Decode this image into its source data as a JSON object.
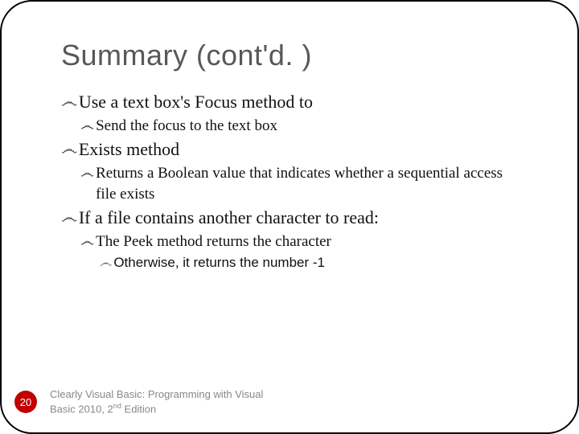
{
  "title": "Summary (cont'd. )",
  "bullets": [
    {
      "level": 1,
      "text": "Use a text box's Focus method to"
    },
    {
      "level": 2,
      "text": "Send the focus to the text box"
    },
    {
      "level": 1,
      "text": "Exists method"
    },
    {
      "level": 2,
      "text": "Returns a Boolean value that indicates whether a sequential access file exists"
    },
    {
      "level": 1,
      "text": "If a file contains another character to read:"
    },
    {
      "level": 2,
      "text": "The Peek method returns the character"
    },
    {
      "level": 3,
      "text": "Otherwise, it returns the number -1"
    }
  ],
  "page_number": "20",
  "footer_line1": "Clearly Visual Basic: Programming with Visual",
  "footer_line2_prefix": "Basic 2010, 2",
  "footer_line2_sup": "nd",
  "footer_line2_suffix": " Edition",
  "bullet_glyph": "෴"
}
